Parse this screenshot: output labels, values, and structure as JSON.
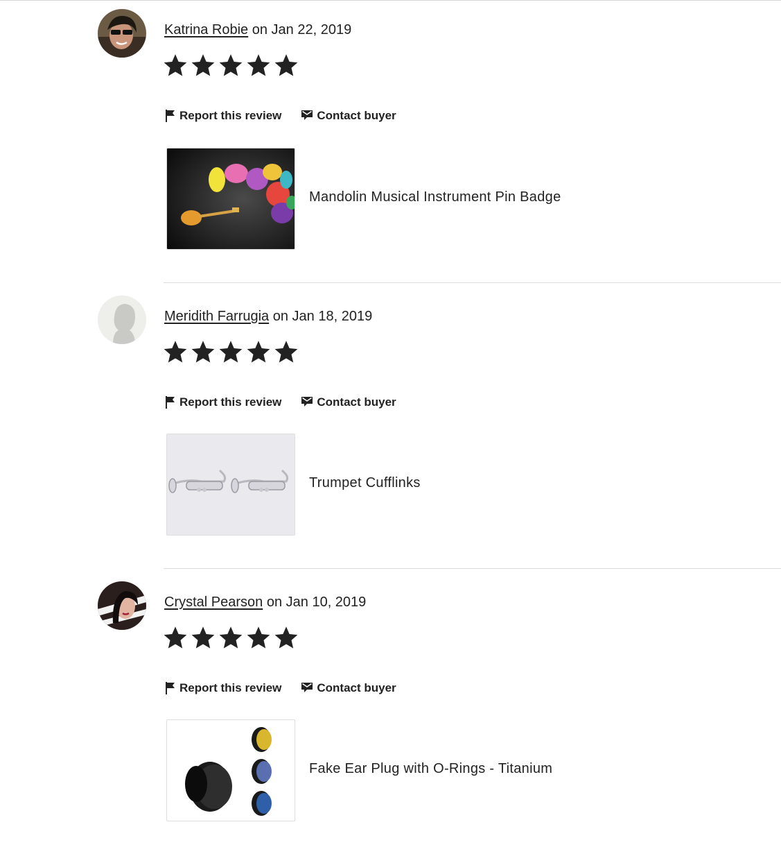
{
  "reviews": [
    {
      "reviewer": "Katrina Robie",
      "date_text": " on Jan 22, 2019",
      "rating": 5,
      "report_label": "Report this review",
      "contact_label": "Contact buyer",
      "listing_title": "Mandolin Musical Instrument Pin Badge"
    },
    {
      "reviewer": "Meridith Farrugia",
      "date_text": " on Jan 18, 2019",
      "rating": 5,
      "report_label": "Report this review",
      "contact_label": "Contact buyer",
      "listing_title": "Trumpet Cufflinks"
    },
    {
      "reviewer": "Crystal Pearson",
      "date_text": " on Jan 10, 2019",
      "rating": 5,
      "report_label": "Report this review",
      "contact_label": "Contact buyer",
      "listing_title": "Fake Ear Plug with O-Rings - Titanium"
    }
  ],
  "colors": {
    "text": "#222222",
    "divider": "#dcdcdc",
    "star": "#222222"
  },
  "icons": {
    "report": "flag-icon",
    "contact": "contact-envelope-icon",
    "star": "star-icon"
  }
}
